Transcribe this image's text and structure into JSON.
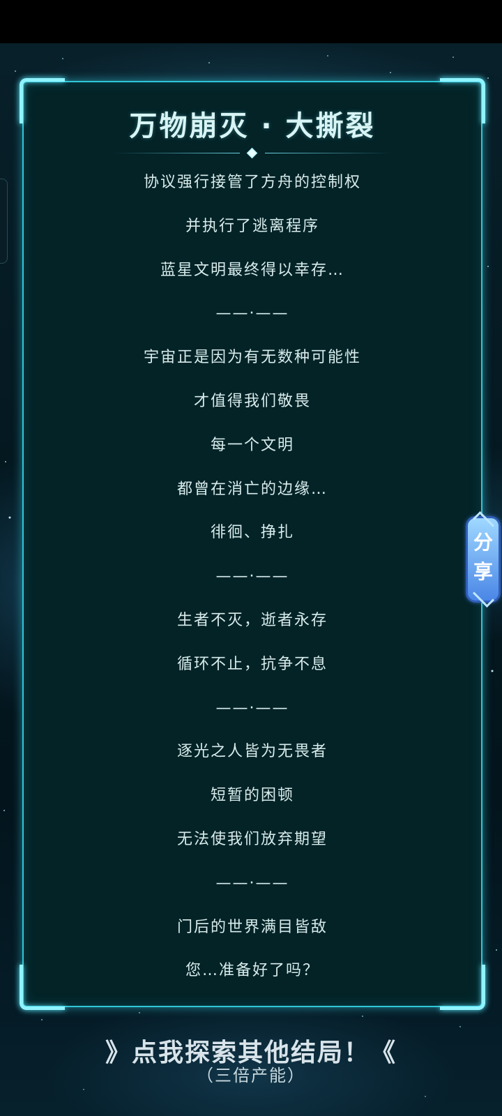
{
  "title": "万物崩灭 · 大撕裂",
  "story_lines": [
    "协议强行接管了方舟的控制权",
    "并执行了逃离程序",
    "蓝星文明最终得以幸存…",
    "——·——",
    "宇宙正是因为有无数种可能性",
    "才值得我们敬畏",
    "每一个文明",
    "都曾在消亡的边缘…",
    "徘徊、挣扎",
    "——·——",
    "生者不灭，逝者永存",
    "循环不止，抗争不息",
    "——·——",
    "逐光之人皆为无畏者",
    "短暂的困顿",
    "无法使我们放弃期望",
    "——·——",
    "门后的世界满目皆敌",
    "您…准备好了吗？"
  ],
  "share_button": {
    "label_line1": "分",
    "label_line2": "享"
  },
  "explore": {
    "label": "》点我探索其他结局！《",
    "sub_label": "（三倍产能）"
  },
  "colors": {
    "panel_bg": "#032327",
    "frame_glow": "#2fc6d8",
    "text": "#d9ecec",
    "share_button": "#4a86e6"
  }
}
